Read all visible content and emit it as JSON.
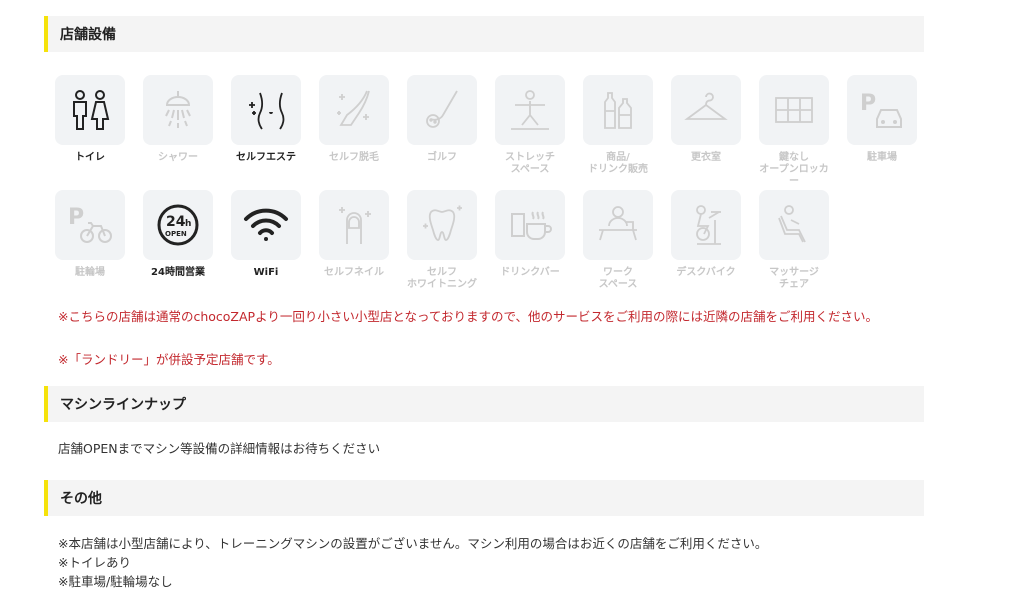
{
  "facilities": {
    "header": "店舗設備",
    "items": [
      {
        "label": "トイレ",
        "icon": "toilet-icon",
        "active": true
      },
      {
        "label": "シャワー",
        "icon": "shower-icon",
        "active": false
      },
      {
        "label": "セルフエステ",
        "icon": "self-esthetic-icon",
        "active": true
      },
      {
        "label": "セルフ脱毛",
        "icon": "self-hair-removal-icon",
        "active": false
      },
      {
        "label": "ゴルフ",
        "icon": "golf-icon",
        "active": false
      },
      {
        "label": "ストレッチ\nスペース",
        "icon": "stretch-space-icon",
        "active": false
      },
      {
        "label": "商品/\nドリンク販売",
        "icon": "drink-sales-icon",
        "active": false
      },
      {
        "label": "更衣室",
        "icon": "changing-room-icon",
        "active": false
      },
      {
        "label": "鍵なし\nオープンロッカー",
        "icon": "open-locker-icon",
        "active": false
      },
      {
        "label": "駐車場",
        "icon": "parking-icon",
        "active": false
      },
      {
        "label": "駐輪場",
        "icon": "bicycle-parking-icon",
        "active": false
      },
      {
        "label": "24時間営業",
        "icon": "open-24h-icon",
        "active": true
      },
      {
        "label": "WiFi",
        "icon": "wifi-icon",
        "active": true
      },
      {
        "label": "セルフネイル",
        "icon": "self-nail-icon",
        "active": false
      },
      {
        "label": "セルフ\nホワイトニング",
        "icon": "self-whitening-icon",
        "active": false
      },
      {
        "label": "ドリンクバー",
        "icon": "drink-bar-icon",
        "active": false
      },
      {
        "label": "ワーク\nスペース",
        "icon": "work-space-icon",
        "active": false
      },
      {
        "label": "デスクバイク",
        "icon": "desk-bike-icon",
        "active": false
      },
      {
        "label": "マッサージ\nチェア",
        "icon": "massage-chair-icon",
        "active": false
      }
    ],
    "notes": [
      "※こちらの店舗は通常のchocoZAPより一回り小さい小型店となっておりますので、他のサービスをご利用の際には近隣の店舗をご利用ください。",
      "※「ランドリー」が併設予定店舗です。"
    ]
  },
  "machines": {
    "header": "マシンラインナップ",
    "text": "店舗OPENまでマシン等設備の詳細情報はお待ちください"
  },
  "other": {
    "header": "その他",
    "notes": [
      "※本店舗は小型店舗により、トレーニングマシンの設置がございません。マシン利用の場合はお近くの店舗をご利用ください。",
      "※トイレあり",
      "※駐車場/駐輪場なし"
    ]
  },
  "colors": {
    "accent_bar": "#f5e20b",
    "header_bg": "#f4f4f4",
    "tile_bg": "#f1f3f5",
    "active_icon": "#222222",
    "inactive_icon": "#cfcfcf",
    "note_red": "#c3282e"
  }
}
